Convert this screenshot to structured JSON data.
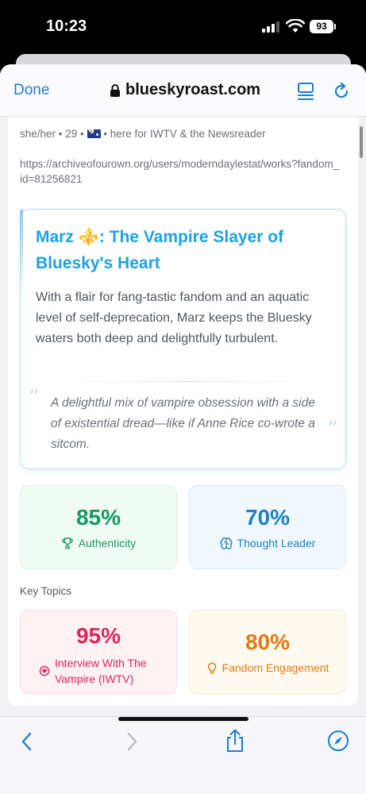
{
  "status_bar": {
    "time": "10:23",
    "battery": "93"
  },
  "browser": {
    "done_label": "Done",
    "url": "blueskyroast.com",
    "icons": {
      "lock": "lock-icon",
      "reader": "reader-icon",
      "reload": "reload-icon"
    }
  },
  "profile": {
    "bio_pronouns": "she/her • 29 •",
    "bio_rest": "• here for IWTV & the Newsreader",
    "link": "https://archiveofourown.org/users/moderndaylestat/works?fandom_id=81256821"
  },
  "roast": {
    "title": "Marz ⚜️: The Vampire Slayer of Bluesky's Heart",
    "text": "With a flair for fang-tastic fandom and an aquatic level of self-deprecation, Marz keeps the Bluesky waters both deep and delightfully turbulent.",
    "quote": "A delightful mix of vampire obsession with a side of existential dread—like if Anne Rice co-wrote a sitcom."
  },
  "stats": [
    {
      "value": "85%",
      "label": "Authenticity",
      "icon": "trophy-icon",
      "color": "#179a5f"
    },
    {
      "value": "70%",
      "label": "Thought Leader",
      "icon": "brain-icon",
      "color": "#1d82c4"
    }
  ],
  "key_topics_label": "Key Topics",
  "topics": [
    {
      "value": "95%",
      "label": "Interview With The Vampire (IWTV)",
      "icon": "heart-icon",
      "color": "#e2245a"
    },
    {
      "value": "80%",
      "label": "Fandom Engagement",
      "icon": "lightbulb-icon",
      "color": "#e37a12"
    }
  ],
  "toolbar": {
    "icons": [
      "back-icon",
      "forward-icon",
      "share-icon",
      "compass-icon"
    ]
  }
}
